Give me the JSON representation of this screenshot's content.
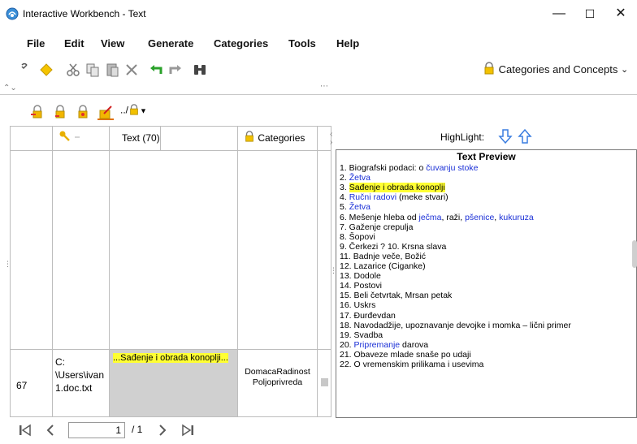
{
  "window": {
    "title": "Interactive Workbench - Text",
    "controls": {
      "minimize": "—",
      "maximize": "☐",
      "close": "✕"
    }
  },
  "menu": [
    "File",
    "Edit",
    "View",
    "Generate",
    "Categories",
    "Tools",
    "Help"
  ],
  "toolbar": {
    "icons": [
      "edit-icon",
      "diamond-icon",
      "cut-icon",
      "copy-icon",
      "paste-icon",
      "delete-icon",
      "undo-icon",
      "redo-icon",
      "binoculars-icon"
    ],
    "dropdown_label": "Categories and Concepts"
  },
  "left_panel": {
    "toolbar_icons": [
      "category-add-icon",
      "category-remove-icon",
      "category-icon",
      "category-highlight-icon",
      "category-path-icon"
    ],
    "path_label": "../",
    "columns": {
      "text": "Text (70)",
      "categories": "Categories"
    },
    "row": {
      "number": "67",
      "path": [
        "C:",
        "\\Users\\ivan",
        "1.doc.txt"
      ],
      "text": "...Sađenje i obrada konoplji...",
      "categories": [
        "DomacaRadinost",
        "Poljoprivreda"
      ]
    }
  },
  "right_panel": {
    "highlight_label": "HighLight:",
    "preview_title": "Text Preview",
    "lines": [
      [
        {
          "t": "1. Biografski podaci: o "
        },
        {
          "t": "čuvanju stoke",
          "c": "blue"
        }
      ],
      [
        {
          "t": "2. "
        },
        {
          "t": "Žetva",
          "c": "blue"
        }
      ],
      [
        {
          "t": "3. "
        },
        {
          "t": "Sađenje i obrada konoplji",
          "c": "hl"
        }
      ],
      [
        {
          "t": "4. "
        },
        {
          "t": "Ručni radovi",
          "c": "blue"
        },
        {
          "t": " (meke stvari)"
        }
      ],
      [
        {
          "t": "5. "
        },
        {
          "t": "Žetva",
          "c": "blue"
        }
      ],
      [
        {
          "t": "6. Mešenje hleba od "
        },
        {
          "t": "ječma",
          "c": "blue"
        },
        {
          "t": ", raži, "
        },
        {
          "t": "pšenice",
          "c": "blue"
        },
        {
          "t": ", "
        },
        {
          "t": "kukuruza",
          "c": "blue"
        }
      ],
      [
        {
          "t": "7. Gaženje crepulja"
        }
      ],
      [
        {
          "t": "8. Šopovi"
        }
      ],
      [
        {
          "t": "9. Čerkezi ? 10. Krsna slava"
        }
      ],
      [
        {
          "t": "11. Badnje veče, Božić"
        }
      ],
      [
        {
          "t": "12. Lazarice (Ciganke)"
        }
      ],
      [
        {
          "t": "13. Dodole"
        }
      ],
      [
        {
          "t": "14. Postovi"
        }
      ],
      [
        {
          "t": "15. Beli četvrtak, Mrsan petak"
        }
      ],
      [
        {
          "t": "16. Uskrs"
        }
      ],
      [
        {
          "t": "17. Đurđevdan"
        }
      ],
      [
        {
          "t": "18. Navodadžije, upoznavanje devojke i momka – lični primer"
        }
      ],
      [
        {
          "t": "19. Svadba"
        }
      ],
      [
        {
          "t": "20. "
        },
        {
          "t": "Pripremanje",
          "c": "blue"
        },
        {
          "t": " darova"
        }
      ],
      [
        {
          "t": "21. Obaveze mlade snaše po udaji"
        }
      ],
      [
        {
          "t": "22. O vremenskim prilikama i usevima"
        }
      ]
    ]
  },
  "pager": {
    "current": "1",
    "total": "/ 1"
  }
}
